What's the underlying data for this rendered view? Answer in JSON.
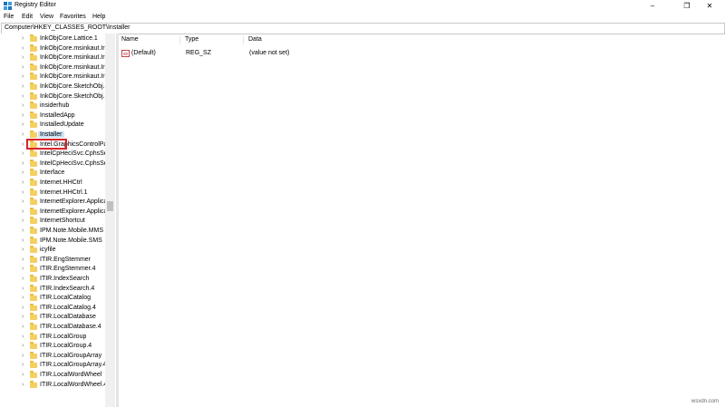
{
  "window": {
    "title": "Registry Editor",
    "controls": {
      "minimize": "–",
      "maximize": "❐",
      "close": "✕"
    }
  },
  "menu": [
    "File",
    "Edit",
    "View",
    "Favorites",
    "Help"
  ],
  "address": "Computer\\HKEY_CLASSES_ROOT\\Installer",
  "tree": {
    "items": [
      "InkObjCore.Lattice.1",
      "InkObjCore.msinkaut.Ir",
      "InkObjCore.msinkaut.Ir",
      "InkObjCore.msinkaut.Ir",
      "InkObjCore.msinkaut.Ir",
      "InkObjCore.SketchObj.S",
      "InkObjCore.SketchObj.S",
      "insiderhub",
      "InstalledApp",
      "InstalledUpdate",
      "Installer",
      "Intel.GraphicsControlPa",
      "IntelCpHeciSvc.CphsSe",
      "IntelCpHeciSvc.CphsSe",
      "Interface",
      "Internet.HHCtrl",
      "Internet.HHCtrl.1",
      "InternetExplorer.Applica",
      "InternetExplorer.Applica",
      "InternetShortcut",
      "IPM.Note.Mobile.MMS",
      "IPM.Note.Mobile.SMS",
      "icyfile",
      "ITIR.EngStemmer",
      "ITIR.EngStemmer.4",
      "ITIR.IndexSearch",
      "ITIR.IndexSearch.4",
      "ITIR.LocalCatalog",
      "ITIR.LocalCatalog.4",
      "ITIR.LocalDatabase",
      "ITIR.LocalDatabase.4",
      "ITIR.LocalGroup",
      "ITIR.LocalGroup.4",
      "ITIR.LocalGroupArray",
      "ITIR.LocalGroupArray.4",
      "ITIR.LocalWordWheel",
      "ITIR.LocalWordWheel.4"
    ],
    "selected_index": 10,
    "chevron": "›"
  },
  "values": {
    "headers": {
      "name": "Name",
      "type": "Type",
      "data": "Data"
    },
    "rows": [
      {
        "icon": "string-value-icon",
        "icon_text": "ab",
        "name": "(Default)",
        "type": "REG_SZ",
        "data": "(value not set)"
      }
    ]
  },
  "watermark": "wsxdn.com",
  "colors": {
    "highlight_border": "#d9232b",
    "folder": "#f5cf62",
    "selection": "#cce4f7"
  }
}
